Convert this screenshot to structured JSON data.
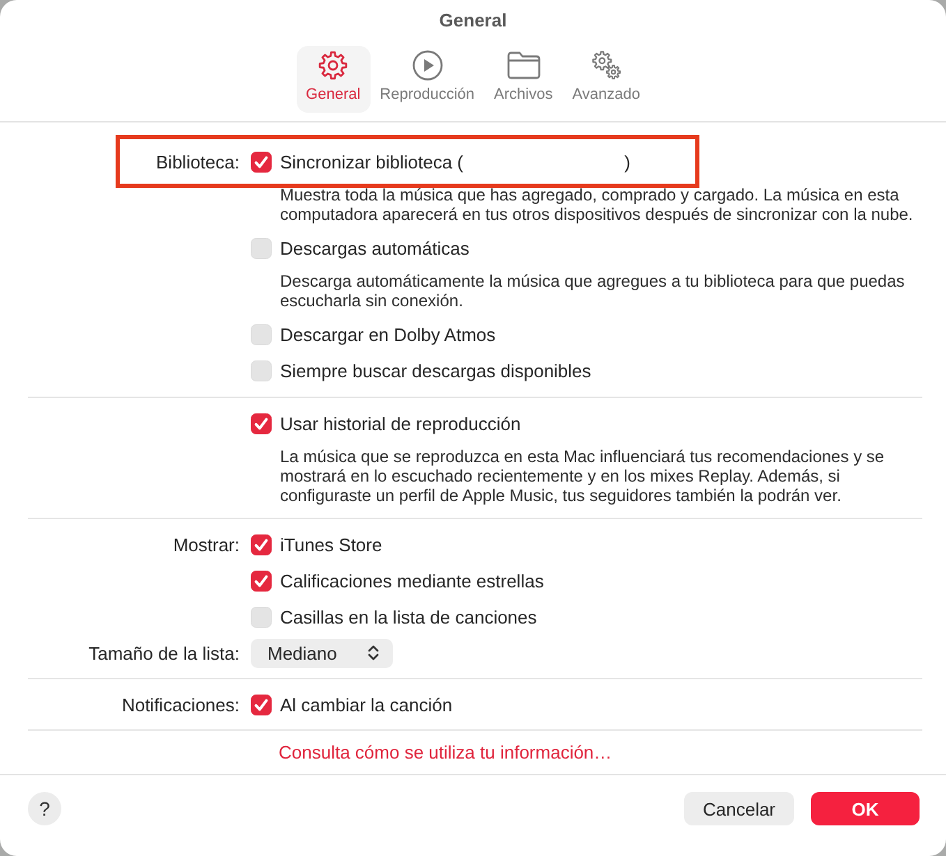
{
  "window": {
    "title": "General"
  },
  "tabs": [
    {
      "label": "General",
      "kind": "gear",
      "selected": true
    },
    {
      "label": "Reproducción",
      "kind": "play",
      "selected": false
    },
    {
      "label": "Archivos",
      "kind": "folder",
      "selected": false
    },
    {
      "label": "Avanzado",
      "kind": "gears",
      "selected": false
    }
  ],
  "sections": [
    {
      "rows": [
        {
          "kind": "checkbox",
          "label": "Biblioteca:",
          "text": "Sincronizar biblioteca (                                )",
          "checked": true,
          "highlighted": true,
          "description": "Muestra toda la música que has agregado, comprado y cargado. La música en esta computadora aparecerá en tus otros dispositivos después de sincronizar con la nube."
        },
        {
          "kind": "checkbox",
          "text": "Descargas automáticas",
          "checked": false,
          "description": "Descarga automáticamente la música que agregues a tu biblioteca para que puedas escucharla sin conexión."
        },
        {
          "kind": "checkbox",
          "text": "Descargar en Dolby Atmos",
          "checked": false
        },
        {
          "kind": "checkbox",
          "text": "Siempre buscar descargas disponibles",
          "checked": false
        }
      ]
    },
    {
      "rows": [
        {
          "kind": "checkbox",
          "text": "Usar historial de reproducción",
          "checked": true,
          "description": "La música que se reproduzca en esta Mac influenciará tus recomendaciones y se mostrará en lo escuchado recientemente y en los mixes Replay. Además, si configuraste un perfil de Apple Music, tus seguidores también la podrán ver."
        }
      ]
    },
    {
      "rows": [
        {
          "kind": "checkbox",
          "label": "Mostrar:",
          "text": "iTunes Store",
          "checked": true
        },
        {
          "kind": "checkbox",
          "text": "Calificaciones mediante estrellas",
          "checked": true
        },
        {
          "kind": "checkbox",
          "text": "Casillas en la lista de canciones",
          "checked": false
        },
        {
          "kind": "popup",
          "label": "Tamaño de la lista:",
          "value": "Mediano"
        }
      ]
    },
    {
      "rows": [
        {
          "kind": "checkbox",
          "label": "Notificaciones:",
          "text": "Al cambiar la canción",
          "checked": true
        }
      ]
    }
  ],
  "privacy_link": {
    "text": "Consulta cómo se utiliza tu información…"
  },
  "footer": {
    "help_button": {
      "label": "?"
    },
    "buttons": [
      {
        "label": "Cancelar",
        "kind": "secondary"
      },
      {
        "label": "OK",
        "kind": "primary"
      }
    ]
  }
}
